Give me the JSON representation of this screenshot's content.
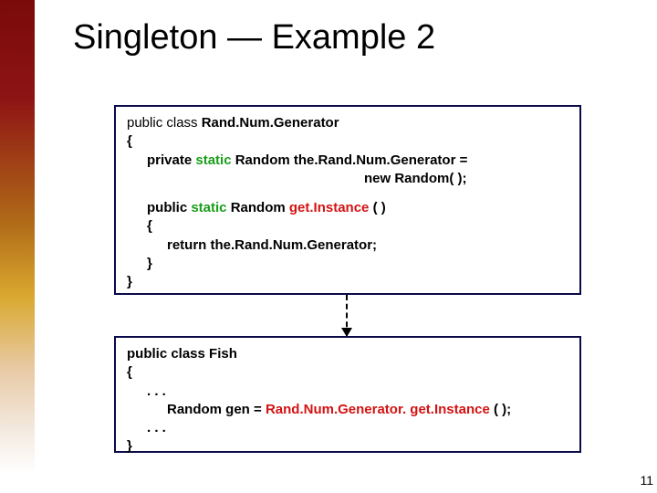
{
  "title": "Singleton — Example 2",
  "box1": {
    "l1a": "public class ",
    "l1b": "Rand.Num.Generator",
    "l2": "{",
    "l3a": "private ",
    "l3b": "static",
    "l3c": " Random the.Rand.Num.Generator =",
    "l4": "new Random( );",
    "l6a": "public ",
    "l6b": "static",
    "l6c": " Random ",
    "l6d": "get.Instance",
    "l6e": " ( )",
    "l7": "{",
    "l8": "return the.Rand.Num.Generator;",
    "l9": "}",
    "l10": "}"
  },
  "box2": {
    "l1": "public class Fish",
    "l2": "{",
    "l3": ". . .",
    "l4a": "Random gen = ",
    "l4b": "Rand.Num.Generator. get.Instance",
    "l4c": " ( );",
    "l5": ". . .",
    "l6": "}"
  },
  "page": "11"
}
